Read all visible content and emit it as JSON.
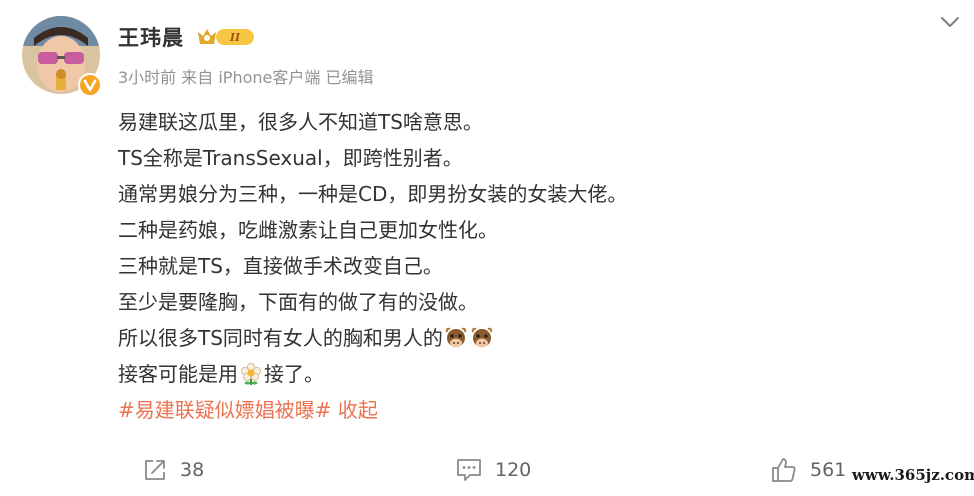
{
  "author": {
    "name": "王玮晨",
    "level_badge_text": "II",
    "avatar_icon": "avatar-image",
    "verify_icon": "verified-badge-icon"
  },
  "meta": {
    "text": "3小时前 来自 iPhone客户端 已编辑"
  },
  "post": {
    "lines": [
      "易建联这瓜里，很多人不知道TS啥意思。",
      "TS全称是TransSexual，即跨性别者。",
      "通常男娘分为三种，一种是CD，即男扮女装的女装大佬。",
      "二种是药娘，吃雌激素让自己更加女性化。",
      "三种就是TS，直接做手术改变自己。",
      "至少是要隆胸，下面有的做了有的没做。",
      "所以很多TS同时有女人的胸和男人的"
    ],
    "line9_before": "接客可能是用",
    "line9_after": "接了。",
    "hashtag": "#易建联疑似嫖娼被曝#",
    "collapse_label": "收起",
    "emoji_icons": [
      "cow-emoji-icon",
      "cow-emoji-icon",
      "flower-emoji-icon"
    ]
  },
  "actions": {
    "repost_count": "38",
    "comment_count": "120",
    "like_count": "561"
  },
  "watermark": "www.365jz.com",
  "colors": {
    "link": "#eb7350",
    "text": "#333333",
    "meta": "#939393",
    "count": "#636363"
  }
}
